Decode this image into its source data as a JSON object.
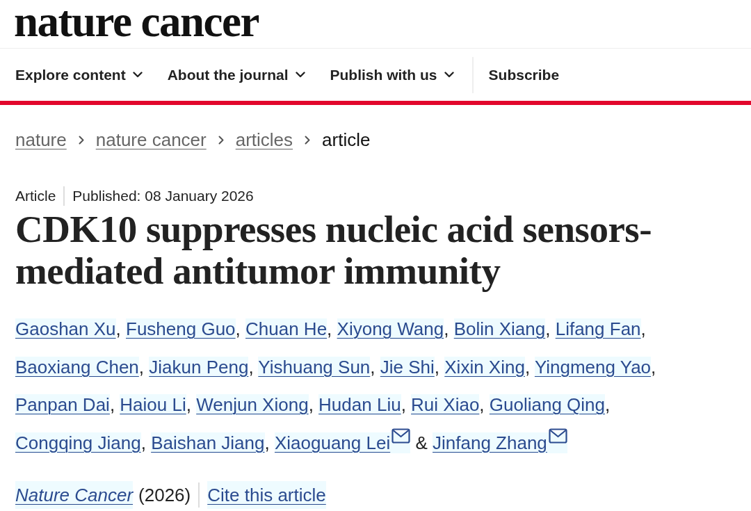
{
  "header": {
    "logo": "nature cancer"
  },
  "nav": [
    {
      "label": "Explore content",
      "kind": "dropdown"
    },
    {
      "label": "About the journal",
      "kind": "dropdown"
    },
    {
      "label": "Publish with us",
      "kind": "dropdown"
    },
    {
      "label": "Subscribe",
      "kind": "link"
    }
  ],
  "breadcrumb": [
    {
      "label": "nature",
      "kind": "link"
    },
    {
      "label": "nature cancer",
      "kind": "link"
    },
    {
      "label": "articles",
      "kind": "link"
    },
    {
      "label": "article",
      "kind": "current"
    }
  ],
  "article": {
    "type": "Article",
    "published": "Published: 08 January 2026",
    "title": "CDK10 suppresses nucleic acid sensors-mediated antitumor immunity",
    "authors": [
      {
        "name": "Gaoshan Xu",
        "corresponding": false,
        "separator": ","
      },
      {
        "name": "Fusheng Guo",
        "corresponding": false,
        "separator": ","
      },
      {
        "name": "Chuan He",
        "corresponding": false,
        "separator": ","
      },
      {
        "name": "Xiyong Wang",
        "corresponding": false,
        "separator": ","
      },
      {
        "name": "Bolin Xiang",
        "corresponding": false,
        "separator": ","
      },
      {
        "name": "Lifang Fan",
        "corresponding": false,
        "separator": ","
      },
      {
        "name": "Baoxiang Chen",
        "corresponding": false,
        "separator": ","
      },
      {
        "name": "Jiakun Peng",
        "corresponding": false,
        "separator": ","
      },
      {
        "name": "Yishuang Sun",
        "corresponding": false,
        "separator": ","
      },
      {
        "name": "Jie Shi",
        "corresponding": false,
        "separator": ","
      },
      {
        "name": "Xixin Xing",
        "corresponding": false,
        "separator": ","
      },
      {
        "name": "Yingmeng Yao",
        "corresponding": false,
        "separator": ","
      },
      {
        "name": "Panpan Dai",
        "corresponding": false,
        "separator": ","
      },
      {
        "name": "Haiou Li",
        "corresponding": false,
        "separator": ","
      },
      {
        "name": "Wenjun Xiong",
        "corresponding": false,
        "separator": ","
      },
      {
        "name": "Hudan Liu",
        "corresponding": false,
        "separator": ","
      },
      {
        "name": "Rui Xiao",
        "corresponding": false,
        "separator": ","
      },
      {
        "name": "Guoliang Qing",
        "corresponding": false,
        "separator": ","
      },
      {
        "name": "Congqing Jiang",
        "corresponding": false,
        "separator": ","
      },
      {
        "name": "Baishan Jiang",
        "corresponding": false,
        "separator": ","
      },
      {
        "name": "Xiaoguang Lei",
        "corresponding": true,
        "separator": "&"
      },
      {
        "name": "Jinfang Zhang",
        "corresponding": true
      }
    ],
    "journal": "Nature Cancer",
    "year": "(2026)",
    "cite_link": "Cite this article"
  }
}
